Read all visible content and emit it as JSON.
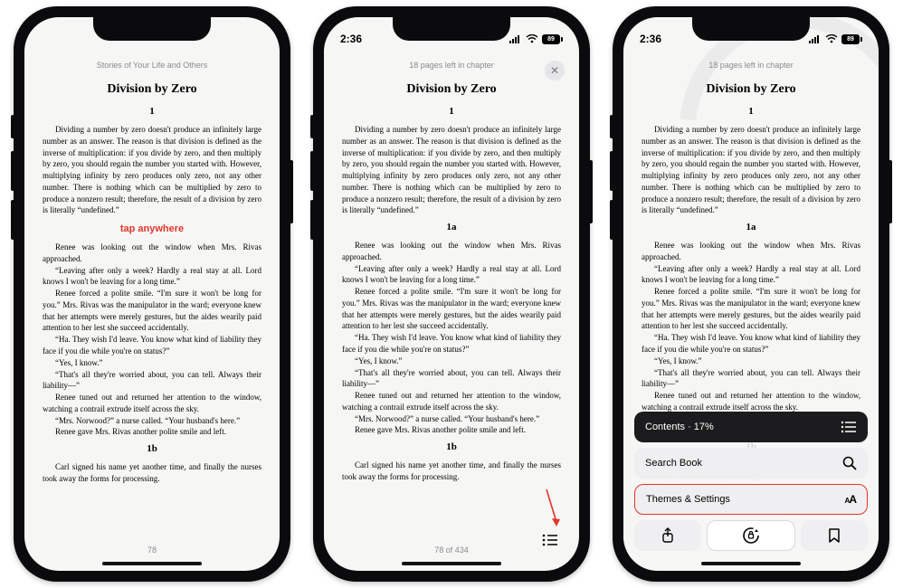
{
  "status": {
    "time": "2:36",
    "battery_pct": "89"
  },
  "book": {
    "header_title": "Stories of Your Life and Others",
    "pages_left": "18 pages left in chapter",
    "chapter": "Division by Zero",
    "section1": "1",
    "para1": "Dividing a number by zero doesn't produce an infinitely large number as an answer. The reason is that division is defined as the inverse of multiplication: if you divide by zero, and then multiply by zero, you should regain the number you started with. However, multiplying infinity by zero produces only zero, not any other number. There is nothing which can be multiplied by zero to produce a nonzero result; therefore, the result of a division by zero is literally “undefined.”",
    "section1a": "1a",
    "para2": "Renee was looking out the window when Mrs. Rivas approached.",
    "para3": "“Leaving after only a week? Hardly a real stay at all. Lord knows I won't be leaving for a long time.”",
    "para4": "Renee forced a polite smile. “I'm sure it won't be long for you.” Mrs. Rivas was the manipulator in the ward; everyone knew that her attempts were merely gestures, but the aides wearily paid attention to her lest she succeed accidentally.",
    "para5": "“Ha. They wish I'd leave. You know what kind of liability they face if you die while you're on status?”",
    "para6": "“Yes, I know.”",
    "para7": "“That's all they're worried about, you can tell. Always their liability—”",
    "para8": "Renee tuned out and returned her attention to the window, watching a contrail extrude itself across the sky.",
    "para9": "“Mrs. Norwood?” a nurse called. “Your husband's here.”",
    "para10": "Renee gave Mrs. Rivas another polite smile and left.",
    "section1b": "1b",
    "para11": "Carl signed his name yet another time, and finally the nurses took away the forms for processing.",
    "page_num_solo": "78",
    "page_num_of": "78 of 434",
    "tap_anywhere": "tap anywhere"
  },
  "menu": {
    "contents": "Contents · 17%",
    "search": "Search Book",
    "themes": "Themes & Settings",
    "aa": "AA"
  }
}
